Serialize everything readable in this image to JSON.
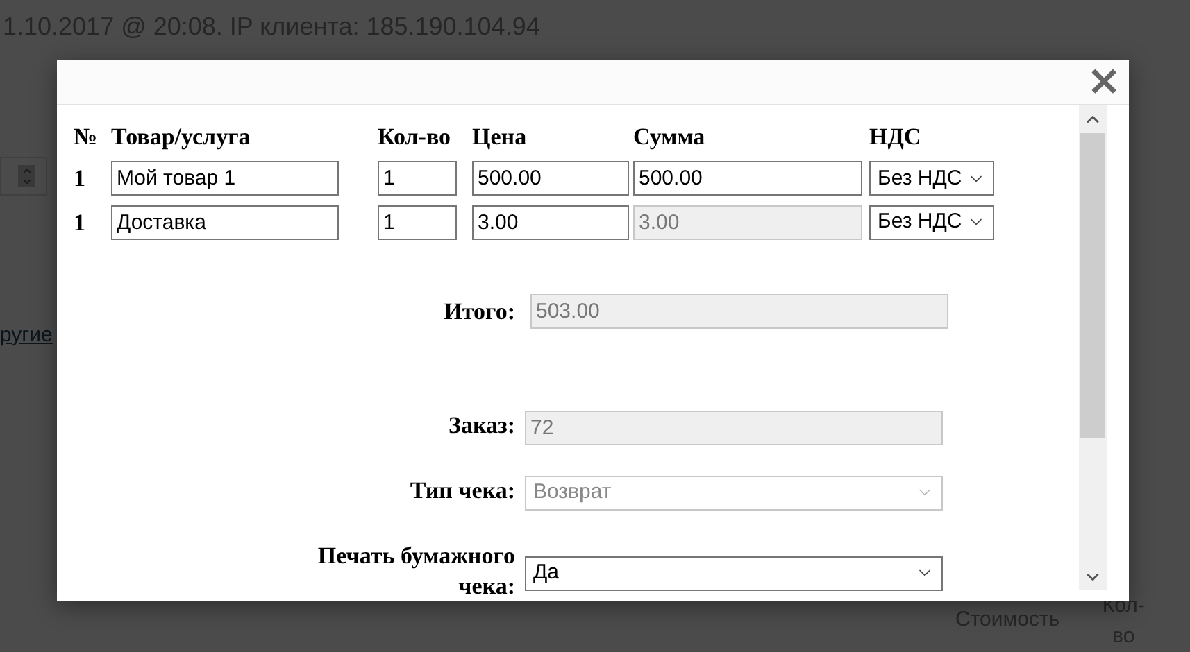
{
  "page_header": "1.10.2017 @ 20:08. IP клиента: 185.190.104.94",
  "background_link": "ругие",
  "background_columns": [
    "Стоимость",
    "Кол-во"
  ],
  "dialog": {
    "close": "×",
    "columns": [
      "№",
      "Товар/услуга",
      "Кол-во",
      "Цена",
      "Сумма",
      "НДС"
    ],
    "rows": [
      {
        "number": "1",
        "item": "Мой товар 1",
        "quantity": "1",
        "price": "500.00",
        "sum": "500.00",
        "sum_disabled": false,
        "vat": "Без НДС"
      },
      {
        "number": "1",
        "item": "Доставка",
        "quantity": "1",
        "price": "3.00",
        "sum": "3.00",
        "sum_disabled": true,
        "vat": "Без НДС"
      }
    ],
    "total": {
      "label": "Итого:",
      "value": "503.00"
    },
    "fields": [
      {
        "label": "Заказ:",
        "value": "72",
        "kind": "text",
        "disabled": true
      },
      {
        "label": "Тип чека:",
        "value": "Возврат",
        "kind": "select",
        "disabled": true
      },
      {
        "label": "Печать бумажного чека:",
        "value": "Да",
        "kind": "select",
        "disabled": false
      }
    ]
  }
}
